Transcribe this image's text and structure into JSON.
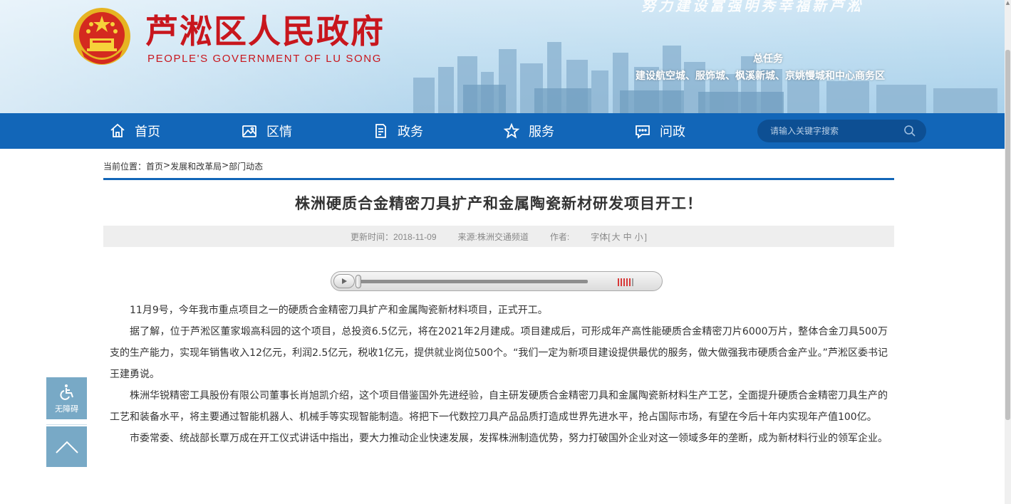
{
  "header": {
    "title": "芦淞区人民政府",
    "subtitle": "PEOPLE'S GOVERNMENT OF  LU SONG",
    "slogan": "努力建设富强明秀幸福新芦淞",
    "task_title": "总任务",
    "task_body": "建设航空城、服饰城、枫溪新城、京姚慢城和中心商务区"
  },
  "nav": {
    "items": [
      {
        "label": "首页",
        "icon": "home-icon"
      },
      {
        "label": "区情",
        "icon": "picture-icon"
      },
      {
        "label": "政务",
        "icon": "document-icon"
      },
      {
        "label": "服务",
        "icon": "star-icon"
      },
      {
        "label": "问政",
        "icon": "chat-icon"
      }
    ],
    "search_placeholder": "请输入关键字搜索"
  },
  "breadcrumb": {
    "prefix": "当前位置：",
    "items": [
      "首页",
      "发展和改革局",
      "部门动态"
    ],
    "separator": " > "
  },
  "article": {
    "title": "株洲硬质合金精密刀具扩产和金属陶瓷新材研发项目开工！",
    "meta": {
      "updated": "更新时间：2018-11-09",
      "source": "来源:株洲交通频道",
      "author": "作者:",
      "fontsize_label": "字体[",
      "fontsize_large": "大",
      "fontsize_medium": "中",
      "fontsize_small": "小",
      "fontsize_end": "]"
    },
    "paragraphs": [
      "11月9号，今年我市重点项目之一的硬质合金精密刀具扩产和金属陶瓷新材料项目，正式开工。",
      "据了解，位于芦淞区董家塅高科园的这个项目，总投资6.5亿元，将在2021年2月建成。项目建成后，可形成年产高性能硬质合金精密刀片6000万片，整体合金刀具500万支的生产能力，实现年销售收入12亿元，利润2.5亿元，税收1亿元，提供就业岗位500个。“我们一定为新项目建设提供最优的服务，做大做强我市硬质合金产业。”芦淞区委书记王建勇说。",
      "株洲华锐精密工具股份有限公司董事长肖旭凯介绍，这个项目借鉴国外先进经验，自主研发硬质合金精密刀具和金属陶瓷新材料生产工艺，全面提升硬质合金精密刀具生产的工艺和装备水平，将主要通过智能机器人、机械手等实现智能制造。将把下一代数控刀具产品品质打造成世界先进水平，抢占国际市场，有望在今后十年内实现年产值100亿。",
      "市委常委、统战部长覃万成在开工仪式讲话中指出，要大力推动企业快速发展，发挥株洲制造优势，努力打破国外企业对这一领域多年的垄断，成为新材料行业的领军企业。"
    ]
  },
  "player": {
    "progress": 0.0,
    "volume_bars_on": 5,
    "volume_bars_total": 6
  },
  "side_tools": {
    "accessibility_label": "无障碍"
  },
  "colors": {
    "brand_red": "#c8161d",
    "nav_blue": "#1266b8",
    "side_tool_blue": "#78a9c6"
  }
}
